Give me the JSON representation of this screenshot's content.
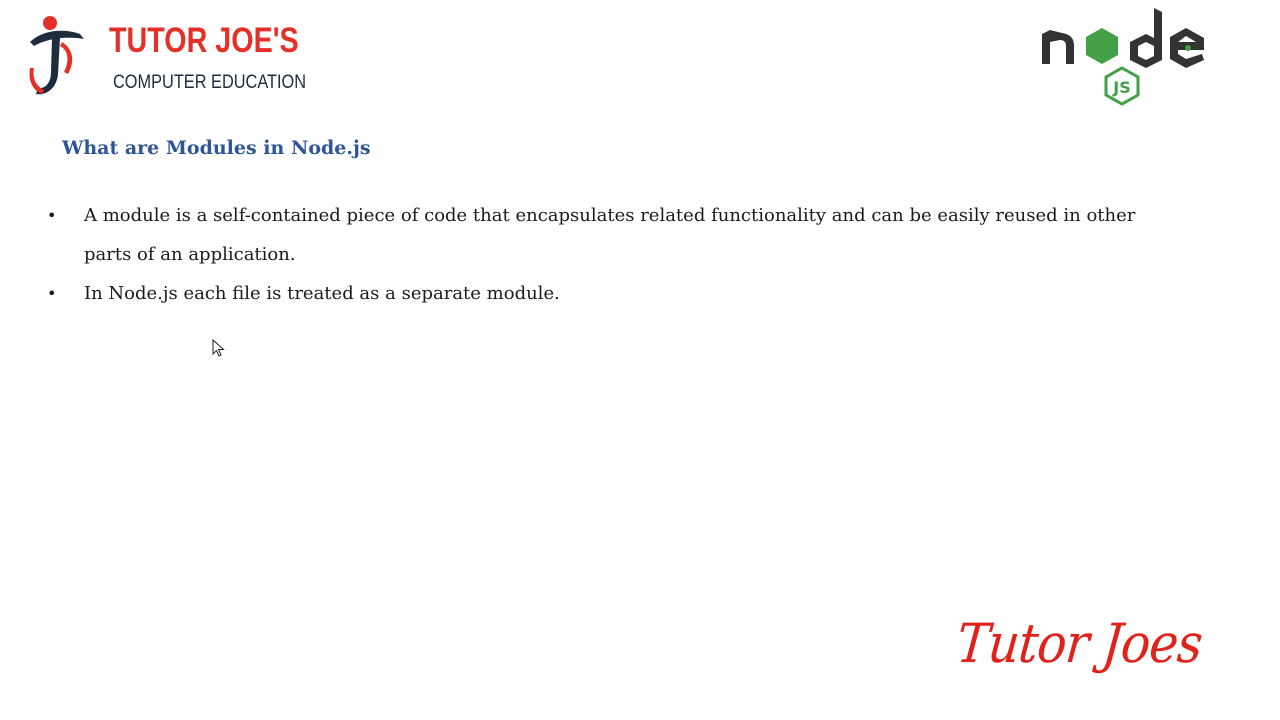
{
  "brand": {
    "name": "TUTOR JOE'S",
    "subtitle": "COMPUTER EDUCATION",
    "colors": {
      "red": "#e53027",
      "dark": "#1d2c3f"
    }
  },
  "node_logo": {
    "icon": "nodejs-logo",
    "colors": {
      "dark": "#333333",
      "green": "#43a047"
    }
  },
  "slide": {
    "title": "What are Modules in Node.js",
    "title_color": "#2f5597",
    "bullets": [
      "A module is a self-contained piece of code that encapsulates related functionality and can be easily reused in other parts of an application.",
      "In Node.js each file is treated as a separate module."
    ],
    "bullet_glyph": "•"
  },
  "signature": {
    "text": "Tutor Joes",
    "color": "#e0221b"
  }
}
